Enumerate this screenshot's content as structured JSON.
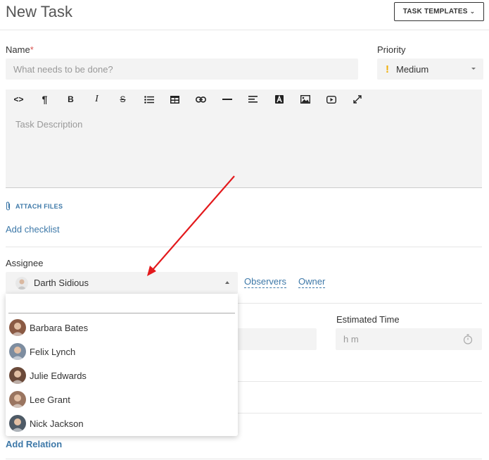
{
  "header": {
    "title": "New Task",
    "templates_button": "TASK TEMPLATES",
    "templates_chevron": "⌄"
  },
  "form": {
    "name_label": "Name",
    "name_required_mark": "*",
    "name_placeholder": "What needs to be done?",
    "priority_label": "Priority",
    "priority_value": "Medium",
    "priority_icon": "!",
    "description_placeholder": "Task Description",
    "toolbar_icons": [
      "code-view-icon",
      "paragraph-icon",
      "bold-icon",
      "italic-icon",
      "strikethrough-icon",
      "bullet-list-icon",
      "table-icon",
      "link-icon",
      "horizontal-rule-icon",
      "align-icon",
      "text-color-icon",
      "image-icon",
      "video-icon",
      "fullscreen-icon"
    ],
    "toolbar_glyphs": [
      "<>",
      "¶",
      "B",
      "I",
      "S"
    ],
    "attach_label": "ATTACH FILES",
    "checklist_label": "Add checklist",
    "assignee_label": "Assignee",
    "assignee_value": "Darth Sidious",
    "observers_link": "Observers",
    "owner_link": "Owner",
    "estimated_label": "Estimated Time",
    "estimated_placeholder": "h m",
    "add_relation": "Add Relation"
  },
  "assignee_dropdown": {
    "search_value": "",
    "options": [
      {
        "name": "Barbara Bates",
        "avatar_color": "#8a5a44"
      },
      {
        "name": "Felix Lynch",
        "avatar_color": "#7d8da0"
      },
      {
        "name": "Julie Edwards",
        "avatar_color": "#6b4a3a"
      },
      {
        "name": "Lee Grant",
        "avatar_color": "#9a7560"
      },
      {
        "name": "Nick Jackson",
        "avatar_color": "#4e5a66"
      }
    ]
  },
  "colors": {
    "link": "#3d78a8",
    "required": "#d9534f",
    "priority_medium": "#f0ad00",
    "annotation_arrow": "#e3191c"
  }
}
